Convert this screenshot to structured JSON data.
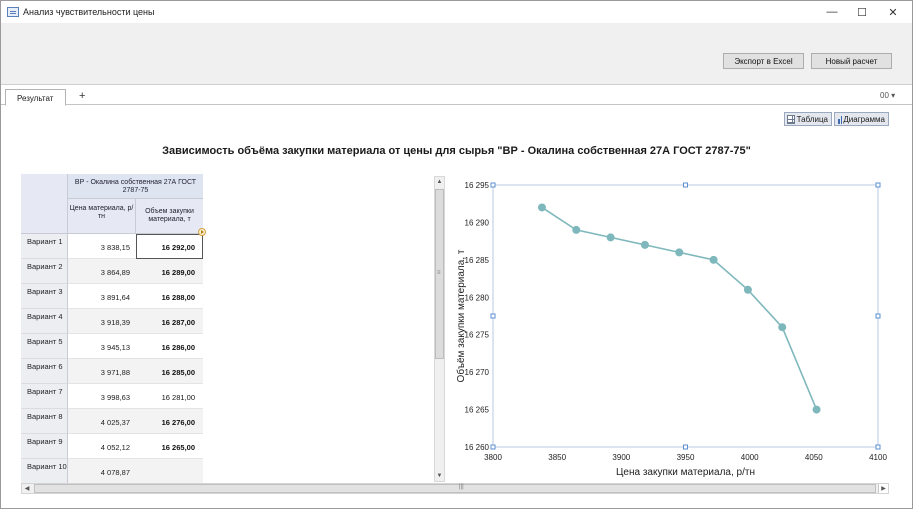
{
  "window": {
    "title": "Анализ чувствительности цены",
    "minimize": "—",
    "maximize": "☐",
    "close": "✕"
  },
  "toolbar": {
    "export_label": "Экспорт в Excel",
    "new_calc_label": "Новый расчет"
  },
  "tabs": {
    "items": [
      {
        "label": "Результат"
      }
    ],
    "add_label": "+",
    "menu_label": "00 ▾"
  },
  "view": {
    "table_label": "Таблица",
    "chart_label": "Диаграмма"
  },
  "page_title": "Зависимость объёма закупки материала от цены для сырья \"ВР - Окалина собственная 27А ГОСТ 2787-75\"",
  "table": {
    "group_header": "ВР - Окалина собственная 27А ГОСТ 2787-75",
    "col_price": "Цена материала, р/тн",
    "col_volume": "Объем закупки материала, т",
    "rows": [
      {
        "label": "Вариант 1",
        "price": "3 838,15",
        "volume": "16 292,00",
        "bold": true
      },
      {
        "label": "Вариант 2",
        "price": "3 864,89",
        "volume": "16 289,00",
        "bold": true
      },
      {
        "label": "Вариант 3",
        "price": "3 891,64",
        "volume": "16 288,00",
        "bold": true
      },
      {
        "label": "Вариант 4",
        "price": "3 918,39",
        "volume": "16 287,00",
        "bold": true
      },
      {
        "label": "Вариант 5",
        "price": "3 945,13",
        "volume": "16 286,00",
        "bold": true
      },
      {
        "label": "Вариант 6",
        "price": "3 971,88",
        "volume": "16 285,00",
        "bold": true
      },
      {
        "label": "Вариант 7",
        "price": "3 998,63",
        "volume": "16 281,00",
        "bold": false
      },
      {
        "label": "Вариант 8",
        "price": "4 025,37",
        "volume": "16 276,00",
        "bold": true
      },
      {
        "label": "Вариант 9",
        "price": "4 052,12",
        "volume": "16 265,00",
        "bold": true
      },
      {
        "label": "Вариант 10",
        "price": "4 078,87",
        "volume": "",
        "bold": false
      }
    ]
  },
  "colors": {
    "series": "#7fb8bc",
    "handle": "#5b8fd0"
  },
  "chart_data": {
    "type": "line",
    "xlabel": "Цена закупки материала, р/тн",
    "ylabel": "Объём закупки материала, т",
    "xlim": [
      3800,
      4100
    ],
    "ylim": [
      16260,
      16295
    ],
    "x_ticks": [
      3800,
      3850,
      3900,
      3950,
      4000,
      4050,
      4100
    ],
    "x_tick_labels": [
      "3800",
      "3850",
      "3900",
      "3950",
      "4000",
      "4050",
      "4100"
    ],
    "y_ticks": [
      16260,
      16265,
      16270,
      16275,
      16280,
      16285,
      16290,
      16295
    ],
    "y_tick_labels": [
      "16 260",
      "16 265",
      "16 270",
      "16 275",
      "16 280",
      "16 285",
      "16 290",
      "16 295"
    ],
    "grid": false,
    "series": [
      {
        "x": [
          3838.15,
          3864.89,
          3891.64,
          3918.39,
          3945.13,
          3971.88,
          3998.63,
          4025.37,
          4052.12
        ],
        "y": [
          16292,
          16289,
          16288,
          16287,
          16286,
          16285,
          16281,
          16276,
          16265
        ]
      }
    ]
  }
}
